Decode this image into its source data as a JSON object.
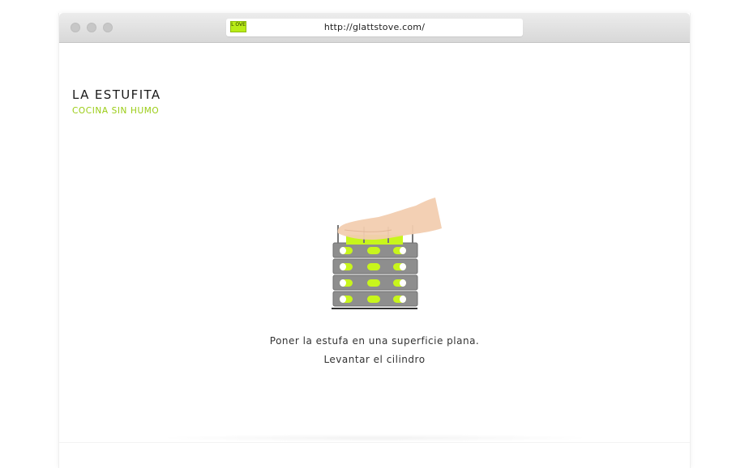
{
  "browser": {
    "url": "http://glattstove.com/",
    "favicon_text": "L OVE",
    "buttons": [
      "close",
      "minimize",
      "zoom"
    ]
  },
  "brand": {
    "title": "LA ESTUFITA",
    "subtitle": "COCINA SIN HUMO"
  },
  "instructions": {
    "line1": "Poner la estufa en una superficie plana.",
    "line2": "Levantar el cilindro"
  },
  "illustration": {
    "icon": "stove-with-hand-icon",
    "accent_color": "#c8f51c",
    "body_color": "#8a8a8a",
    "hand_color": "#f2cdb0"
  },
  "colors": {
    "brand_green": "#9acc14",
    "text_dark": "#1a1a1a"
  }
}
